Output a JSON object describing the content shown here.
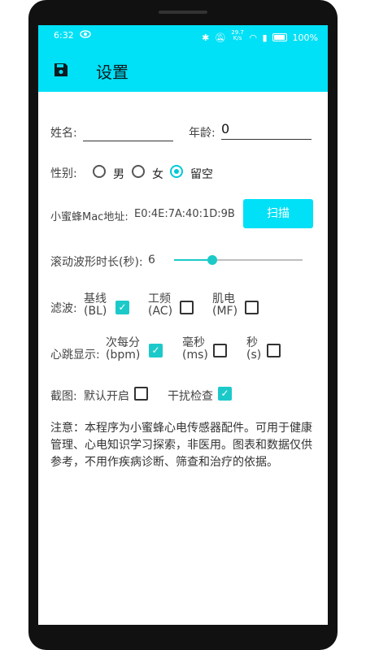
{
  "statusbar": {
    "time": "6:32",
    "eye_icon": "eye-icon",
    "net_top": "29.7",
    "net_bottom": "K/s",
    "battery_pct": "100%"
  },
  "appbar": {
    "title": "设置",
    "save_icon": "save-icon"
  },
  "form": {
    "name_label": "姓名:",
    "name_value": "",
    "age_label": "年龄:",
    "age_value": "0",
    "gender_label": "性别:",
    "gender_options": [
      "男",
      "女",
      "留空"
    ],
    "gender_selected": "留空",
    "mac_label": "小蜜蜂Mac地址:",
    "mac_value": "E0:4E:7A:40:1D:9B",
    "scan_button": "扫描",
    "duration_label": "滚动波形时长(秒):",
    "duration_value": "6",
    "duration_slider_fraction": 0.3,
    "filter_label": "滤波:",
    "filter_bl_line1": "基线",
    "filter_bl_line2": "(BL)",
    "filter_bl_checked": true,
    "filter_ac_line1": "工频",
    "filter_ac_line2": "(AC)",
    "filter_ac_checked": false,
    "filter_mf_line1": "肌电",
    "filter_mf_line2": "(MF)",
    "filter_mf_checked": false,
    "hr_label": "心跳显示:",
    "hr_bpm_line1": "次每分",
    "hr_bpm_line2": "(bpm)",
    "hr_bpm_checked": true,
    "hr_ms_line1": "毫秒",
    "hr_ms_line2": "(ms)",
    "hr_ms_checked": false,
    "hr_s_line1": "秒",
    "hr_s_line2": "(s)",
    "hr_s_checked": false,
    "shot_label": "截图:",
    "shot_default_label": "默认开启",
    "shot_default_checked": false,
    "shot_interfere_label": "干扰检查",
    "shot_interfere_checked": true,
    "notice": "注意：本程序为小蜜蜂心电传感器配件。可用于健康管理、心电知识学习探索，非医用。图表和数据仅供参考，不用作疾病诊断、筛查和治疗的依据。"
  },
  "colors": {
    "accent": "#00e0f6",
    "check": "#1cc9c9"
  }
}
